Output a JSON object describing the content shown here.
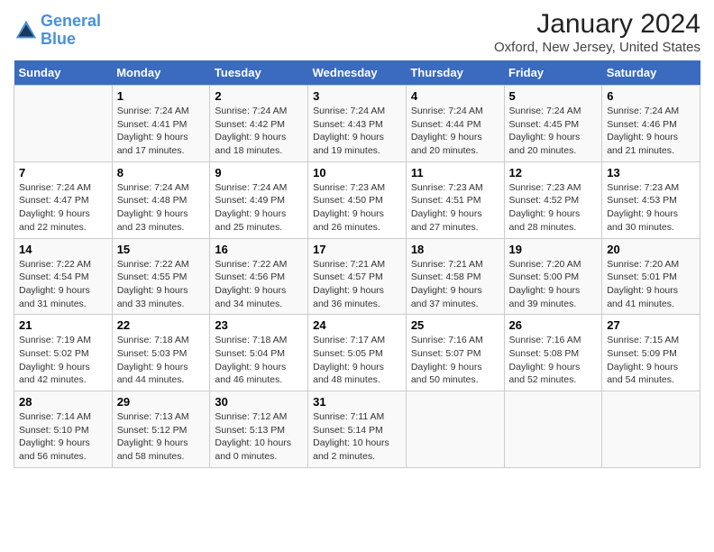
{
  "header": {
    "logo_line1": "General",
    "logo_line2": "Blue",
    "title": "January 2024",
    "subtitle": "Oxford, New Jersey, United States"
  },
  "days_of_week": [
    "Sunday",
    "Monday",
    "Tuesday",
    "Wednesday",
    "Thursday",
    "Friday",
    "Saturday"
  ],
  "weeks": [
    [
      {
        "day": "",
        "sunrise": "",
        "sunset": "",
        "daylight": ""
      },
      {
        "day": "1",
        "sunrise": "Sunrise: 7:24 AM",
        "sunset": "Sunset: 4:41 PM",
        "daylight": "Daylight: 9 hours and 17 minutes."
      },
      {
        "day": "2",
        "sunrise": "Sunrise: 7:24 AM",
        "sunset": "Sunset: 4:42 PM",
        "daylight": "Daylight: 9 hours and 18 minutes."
      },
      {
        "day": "3",
        "sunrise": "Sunrise: 7:24 AM",
        "sunset": "Sunset: 4:43 PM",
        "daylight": "Daylight: 9 hours and 19 minutes."
      },
      {
        "day": "4",
        "sunrise": "Sunrise: 7:24 AM",
        "sunset": "Sunset: 4:44 PM",
        "daylight": "Daylight: 9 hours and 20 minutes."
      },
      {
        "day": "5",
        "sunrise": "Sunrise: 7:24 AM",
        "sunset": "Sunset: 4:45 PM",
        "daylight": "Daylight: 9 hours and 20 minutes."
      },
      {
        "day": "6",
        "sunrise": "Sunrise: 7:24 AM",
        "sunset": "Sunset: 4:46 PM",
        "daylight": "Daylight: 9 hours and 21 minutes."
      }
    ],
    [
      {
        "day": "7",
        "sunrise": "Sunrise: 7:24 AM",
        "sunset": "Sunset: 4:47 PM",
        "daylight": "Daylight: 9 hours and 22 minutes."
      },
      {
        "day": "8",
        "sunrise": "Sunrise: 7:24 AM",
        "sunset": "Sunset: 4:48 PM",
        "daylight": "Daylight: 9 hours and 23 minutes."
      },
      {
        "day": "9",
        "sunrise": "Sunrise: 7:24 AM",
        "sunset": "Sunset: 4:49 PM",
        "daylight": "Daylight: 9 hours and 25 minutes."
      },
      {
        "day": "10",
        "sunrise": "Sunrise: 7:23 AM",
        "sunset": "Sunset: 4:50 PM",
        "daylight": "Daylight: 9 hours and 26 minutes."
      },
      {
        "day": "11",
        "sunrise": "Sunrise: 7:23 AM",
        "sunset": "Sunset: 4:51 PM",
        "daylight": "Daylight: 9 hours and 27 minutes."
      },
      {
        "day": "12",
        "sunrise": "Sunrise: 7:23 AM",
        "sunset": "Sunset: 4:52 PM",
        "daylight": "Daylight: 9 hours and 28 minutes."
      },
      {
        "day": "13",
        "sunrise": "Sunrise: 7:23 AM",
        "sunset": "Sunset: 4:53 PM",
        "daylight": "Daylight: 9 hours and 30 minutes."
      }
    ],
    [
      {
        "day": "14",
        "sunrise": "Sunrise: 7:22 AM",
        "sunset": "Sunset: 4:54 PM",
        "daylight": "Daylight: 9 hours and 31 minutes."
      },
      {
        "day": "15",
        "sunrise": "Sunrise: 7:22 AM",
        "sunset": "Sunset: 4:55 PM",
        "daylight": "Daylight: 9 hours and 33 minutes."
      },
      {
        "day": "16",
        "sunrise": "Sunrise: 7:22 AM",
        "sunset": "Sunset: 4:56 PM",
        "daylight": "Daylight: 9 hours and 34 minutes."
      },
      {
        "day": "17",
        "sunrise": "Sunrise: 7:21 AM",
        "sunset": "Sunset: 4:57 PM",
        "daylight": "Daylight: 9 hours and 36 minutes."
      },
      {
        "day": "18",
        "sunrise": "Sunrise: 7:21 AM",
        "sunset": "Sunset: 4:58 PM",
        "daylight": "Daylight: 9 hours and 37 minutes."
      },
      {
        "day": "19",
        "sunrise": "Sunrise: 7:20 AM",
        "sunset": "Sunset: 5:00 PM",
        "daylight": "Daylight: 9 hours and 39 minutes."
      },
      {
        "day": "20",
        "sunrise": "Sunrise: 7:20 AM",
        "sunset": "Sunset: 5:01 PM",
        "daylight": "Daylight: 9 hours and 41 minutes."
      }
    ],
    [
      {
        "day": "21",
        "sunrise": "Sunrise: 7:19 AM",
        "sunset": "Sunset: 5:02 PM",
        "daylight": "Daylight: 9 hours and 42 minutes."
      },
      {
        "day": "22",
        "sunrise": "Sunrise: 7:18 AM",
        "sunset": "Sunset: 5:03 PM",
        "daylight": "Daylight: 9 hours and 44 minutes."
      },
      {
        "day": "23",
        "sunrise": "Sunrise: 7:18 AM",
        "sunset": "Sunset: 5:04 PM",
        "daylight": "Daylight: 9 hours and 46 minutes."
      },
      {
        "day": "24",
        "sunrise": "Sunrise: 7:17 AM",
        "sunset": "Sunset: 5:05 PM",
        "daylight": "Daylight: 9 hours and 48 minutes."
      },
      {
        "day": "25",
        "sunrise": "Sunrise: 7:16 AM",
        "sunset": "Sunset: 5:07 PM",
        "daylight": "Daylight: 9 hours and 50 minutes."
      },
      {
        "day": "26",
        "sunrise": "Sunrise: 7:16 AM",
        "sunset": "Sunset: 5:08 PM",
        "daylight": "Daylight: 9 hours and 52 minutes."
      },
      {
        "day": "27",
        "sunrise": "Sunrise: 7:15 AM",
        "sunset": "Sunset: 5:09 PM",
        "daylight": "Daylight: 9 hours and 54 minutes."
      }
    ],
    [
      {
        "day": "28",
        "sunrise": "Sunrise: 7:14 AM",
        "sunset": "Sunset: 5:10 PM",
        "daylight": "Daylight: 9 hours and 56 minutes."
      },
      {
        "day": "29",
        "sunrise": "Sunrise: 7:13 AM",
        "sunset": "Sunset: 5:12 PM",
        "daylight": "Daylight: 9 hours and 58 minutes."
      },
      {
        "day": "30",
        "sunrise": "Sunrise: 7:12 AM",
        "sunset": "Sunset: 5:13 PM",
        "daylight": "Daylight: 10 hours and 0 minutes."
      },
      {
        "day": "31",
        "sunrise": "Sunrise: 7:11 AM",
        "sunset": "Sunset: 5:14 PM",
        "daylight": "Daylight: 10 hours and 2 minutes."
      },
      {
        "day": "",
        "sunrise": "",
        "sunset": "",
        "daylight": ""
      },
      {
        "day": "",
        "sunrise": "",
        "sunset": "",
        "daylight": ""
      },
      {
        "day": "",
        "sunrise": "",
        "sunset": "",
        "daylight": ""
      }
    ]
  ]
}
